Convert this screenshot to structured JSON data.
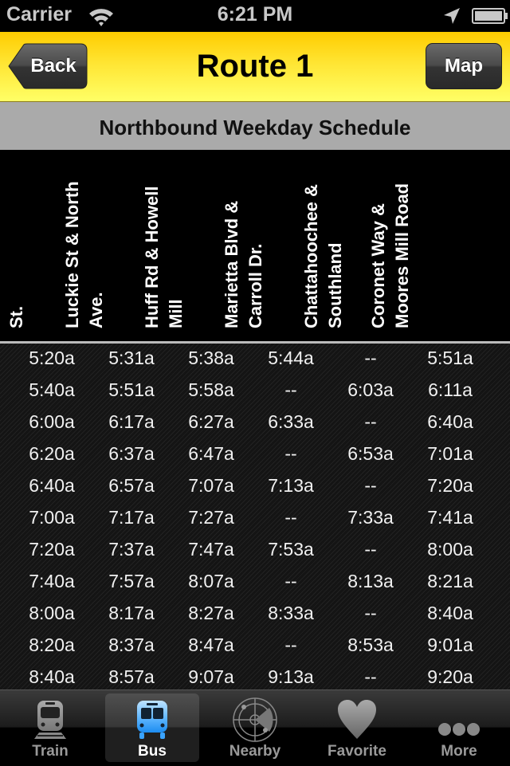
{
  "status_bar": {
    "carrier": "Carrier",
    "time": "6:21 PM",
    "icons": [
      "wifi-icon",
      "location-arrow-icon",
      "battery-icon"
    ]
  },
  "navbar": {
    "title": "Route 1",
    "back_label": "Back",
    "map_label": "Map",
    "color": "#ffdd22"
  },
  "schedule": {
    "title": "Northbound Weekday Schedule",
    "columns": [
      "Alabama & Broad St.",
      "Luckie St & North Ave.",
      "Huff Rd & Howell Mill",
      "Marietta Blvd & Carroll Dr.",
      "Chattahoochee & Southland",
      "Coronet Way & Moores Mill Road"
    ],
    "rows": [
      [
        "5:20a",
        "5:31a",
        "5:38a",
        "5:44a",
        "--",
        "5:51a"
      ],
      [
        "5:40a",
        "5:51a",
        "5:58a",
        "--",
        "6:03a",
        "6:11a"
      ],
      [
        "6:00a",
        "6:17a",
        "6:27a",
        "6:33a",
        "--",
        "6:40a"
      ],
      [
        "6:20a",
        "6:37a",
        "6:47a",
        "--",
        "6:53a",
        "7:01a"
      ],
      [
        "6:40a",
        "6:57a",
        "7:07a",
        "7:13a",
        "--",
        "7:20a"
      ],
      [
        "7:00a",
        "7:17a",
        "7:27a",
        "--",
        "7:33a",
        "7:41a"
      ],
      [
        "7:20a",
        "7:37a",
        "7:47a",
        "7:53a",
        "--",
        "8:00a"
      ],
      [
        "7:40a",
        "7:57a",
        "8:07a",
        "--",
        "8:13a",
        "8:21a"
      ],
      [
        "8:00a",
        "8:17a",
        "8:27a",
        "8:33a",
        "--",
        "8:40a"
      ],
      [
        "8:20a",
        "8:37a",
        "8:47a",
        "--",
        "8:53a",
        "9:01a"
      ],
      [
        "8:40a",
        "8:57a",
        "9:07a",
        "9:13a",
        "--",
        "9:20a"
      ]
    ]
  },
  "tabbar": {
    "active": "Bus",
    "items": [
      {
        "label": "Train",
        "icon": "train-icon"
      },
      {
        "label": "Bus",
        "icon": "bus-icon"
      },
      {
        "label": "Nearby",
        "icon": "radar-icon"
      },
      {
        "label": "Favorite",
        "icon": "heart-icon"
      },
      {
        "label": "More",
        "icon": "more-dots-icon"
      }
    ]
  }
}
